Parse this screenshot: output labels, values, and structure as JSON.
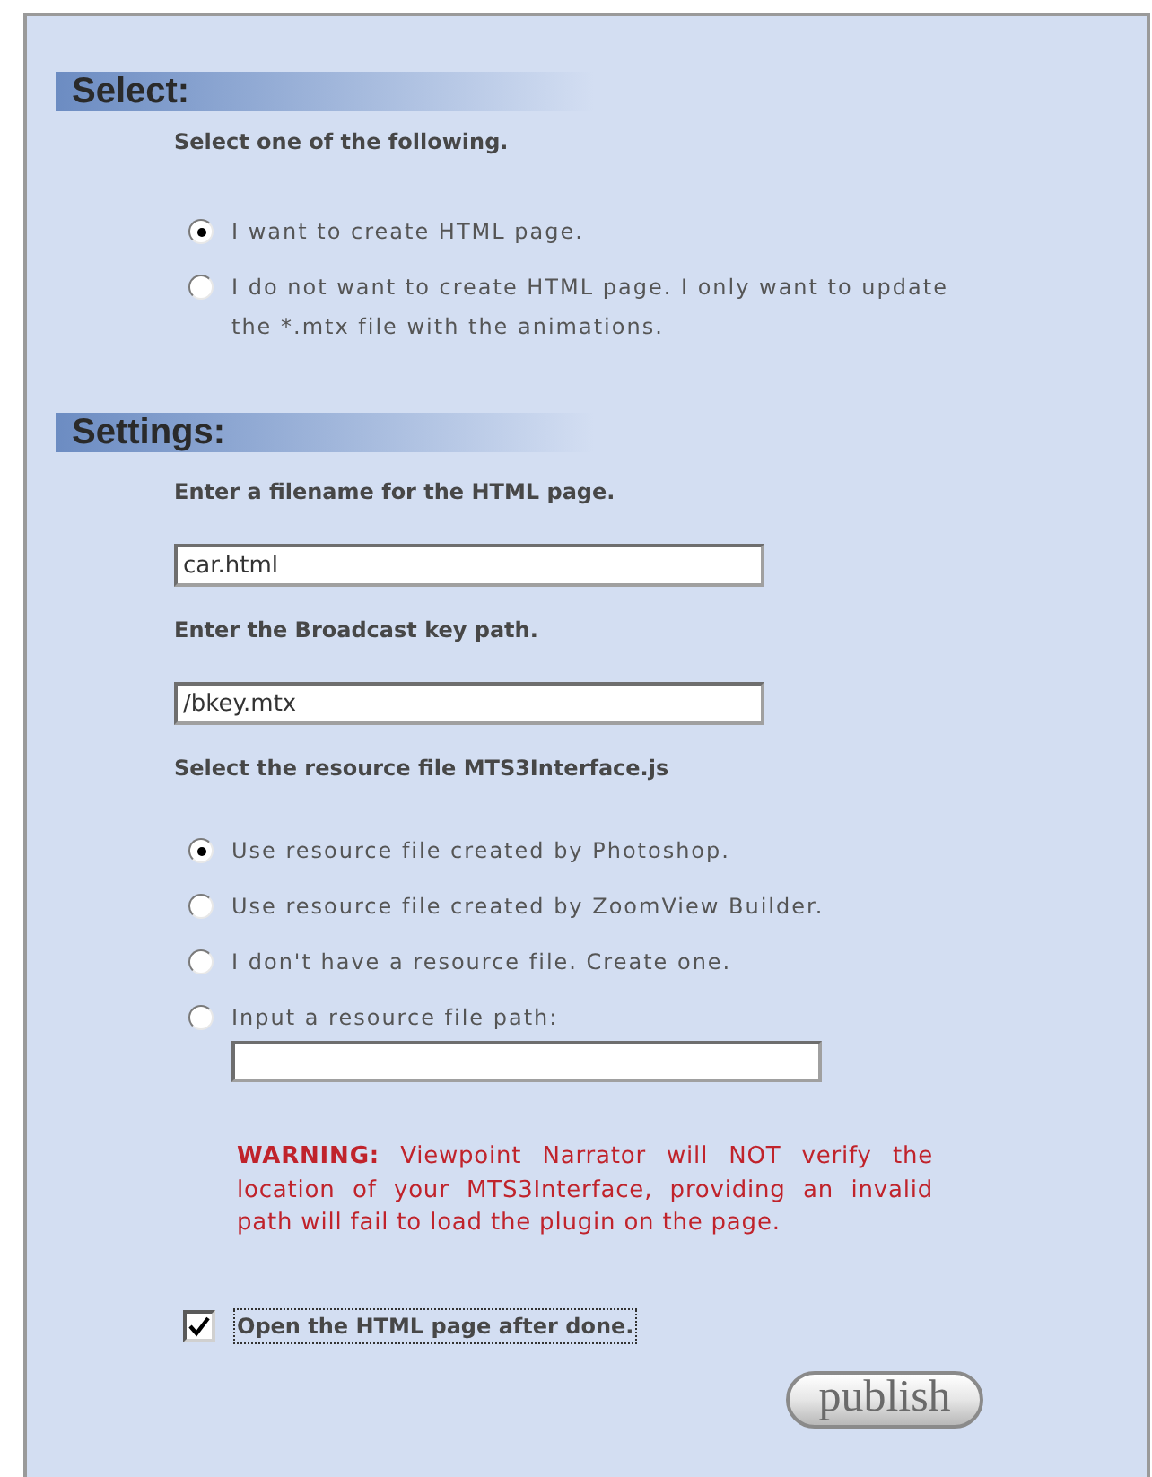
{
  "sections": [
    {
      "title": "Select:",
      "content": [
        {
          "kind": "label",
          "text": "Select one of the following."
        },
        {
          "kind": "radio_group",
          "options": [
            {
              "label": "I want to create HTML page.",
              "selected": true
            },
            {
              "label": "I do not want to create HTML page. I only want to update the *.mtx file with the animations.",
              "selected": false
            }
          ]
        }
      ]
    },
    {
      "title": "Settings:",
      "content": [
        {
          "kind": "label",
          "text": "Enter a filename for the HTML page."
        },
        {
          "kind": "field",
          "value": "car.html"
        },
        {
          "kind": "label",
          "text": "Enter the Broadcast key path."
        },
        {
          "kind": "field",
          "value": "/bkey.mtx"
        },
        {
          "kind": "label",
          "text": "Select the resource file MTS3Interface.js"
        },
        {
          "kind": "radio_group",
          "options": [
            {
              "label": "Use resource file created by Photoshop.",
              "selected": true
            },
            {
              "label": "Use resource file created by ZoomView Builder.",
              "selected": false
            },
            {
              "label": "I don't have a resource file. Create one.",
              "selected": false
            },
            {
              "label": "Input a resource file path:",
              "selected": false,
              "with_input": true
            }
          ]
        },
        {
          "kind": "warning",
          "text": "**WARNING:** Viewpoint Narrator will NOT verify the location of your MTS3Interface, providing an invalid path will fail to load the plugin on the page."
        },
        {
          "kind": "checkbox",
          "label": "Open the HTML page after done.",
          "checked": true,
          "focused": true
        }
      ]
    }
  ],
  "button": "publish"
}
